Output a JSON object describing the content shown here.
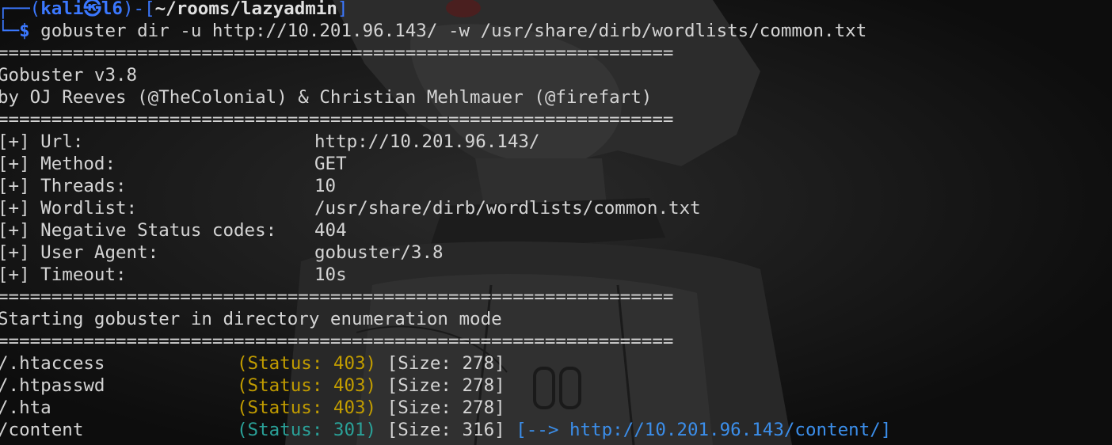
{
  "prompt": {
    "top_left": "┌──(",
    "user": "kali",
    "at_icon": "㉿",
    "host": "l6",
    "mid": ")-[",
    "dir": "~/rooms/lazyadmin",
    "close": "]",
    "bottom_left": "└─",
    "dollar": "$",
    "command": " gobuster dir -u http://10.201.96.143/ -w /usr/share/dirb/wordlists/common.txt"
  },
  "separator": "===============================================================",
  "banner": {
    "version": "Gobuster v3.8",
    "authors": "by OJ Reeves (@TheColonial) & Christian Mehlmauer (@firefart)"
  },
  "config": [
    {
      "key": "[+] Url:",
      "value": "http://10.201.96.143/"
    },
    {
      "key": "[+] Method:",
      "value": "GET"
    },
    {
      "key": "[+] Threads:",
      "value": "10"
    },
    {
      "key": "[+] Wordlist:",
      "value": "/usr/share/dirb/wordlists/common.txt"
    },
    {
      "key": "[+] Negative Status codes:",
      "value": "404"
    },
    {
      "key": "[+] User Agent:",
      "value": "gobuster/3.8"
    },
    {
      "key": "[+] Timeout:",
      "value": "10s"
    }
  ],
  "start_message": "Starting gobuster in directory enumeration mode",
  "results": [
    {
      "path": "/.htaccess",
      "status": "(Status: 403)",
      "size": " [Size: 278]",
      "redirect": ""
    },
    {
      "path": "/.htpasswd",
      "status": "(Status: 403)",
      "size": " [Size: 278]",
      "redirect": ""
    },
    {
      "path": "/.hta",
      "status": "(Status: 403)",
      "size": " [Size: 278]",
      "redirect": ""
    },
    {
      "path": "/content",
      "status": "(Status: 301)",
      "size": " [Size: 316]",
      "redirect": " [--> http://10.201.96.143/content/]"
    }
  ],
  "colors": {
    "background": "#0d0d0d",
    "foreground": "#d4d4d4",
    "prompt_blue": "#3b78ff",
    "status_403": "#c19c00",
    "status_301": "#2aa198",
    "redirect_link": "#3b8eea"
  }
}
